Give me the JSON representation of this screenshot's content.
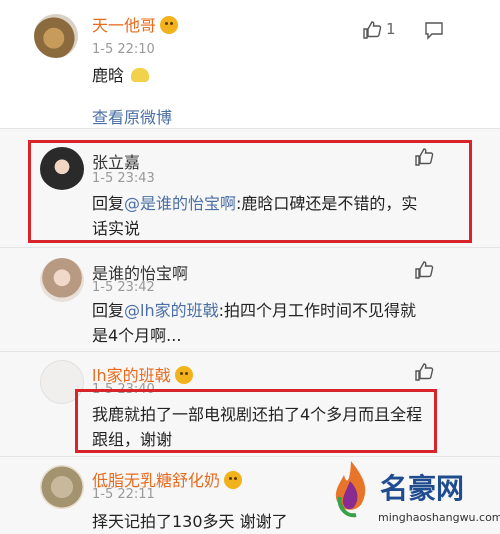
{
  "comments": [
    {
      "name": "天一他哥",
      "time": "1-5 22:10",
      "text": "鹿晗",
      "link": "查看原微博",
      "likes": "1"
    },
    {
      "name": "张立嘉",
      "time": "1-5 23:43",
      "prefix": "回复",
      "mention": "@是谁的怡宝啊",
      "text": ":鹿晗口碑还是不错的，实话实说"
    },
    {
      "name": "是谁的怡宝啊",
      "time": "1-5 23:42",
      "prefix": "回复",
      "mention": "@lh家的班戟",
      "text": ":拍四个月工作时间不见得就是4个月啊..."
    },
    {
      "name": "lh家的班戟",
      "time": "1-5 23:40",
      "text": "我鹿就拍了一部电视剧还拍了4个多月而且全程跟组，谢谢"
    },
    {
      "name": "低脂无乳糖舒化奶",
      "time": "1-5 22:11",
      "text": "择天记拍了130多天 谢谢了"
    }
  ],
  "watermark": {
    "brand": "名豪网",
    "url": "minghaoshangwu.com"
  },
  "colors": {
    "orange": "#e86a1e",
    "link": "#4a6fa5",
    "red": "#d8232a"
  }
}
